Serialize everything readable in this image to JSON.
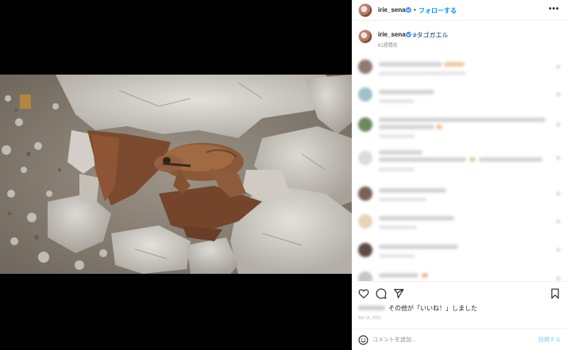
{
  "post": {
    "username": "irie_sena",
    "header_separator": "•",
    "follow_label": "フォローする",
    "more_label": "•••",
    "caption_hashtag": "#タゴガエル",
    "caption_time": "61週間前",
    "likes_text": "その他が「いいね！」しました",
    "date_text": "9月 16, 2021"
  },
  "comment_box": {
    "placeholder": "コメントを追加...",
    "post_label": "投稿する"
  },
  "icons": {
    "like": "heart-icon",
    "comment": "comment-icon",
    "share": "share-icon",
    "save": "bookmark-icon",
    "emoji": "emoji-icon"
  },
  "colors": {
    "link_blue": "#0095f6",
    "verified_blue": "#3897f0",
    "hashtag": "#00376b"
  }
}
